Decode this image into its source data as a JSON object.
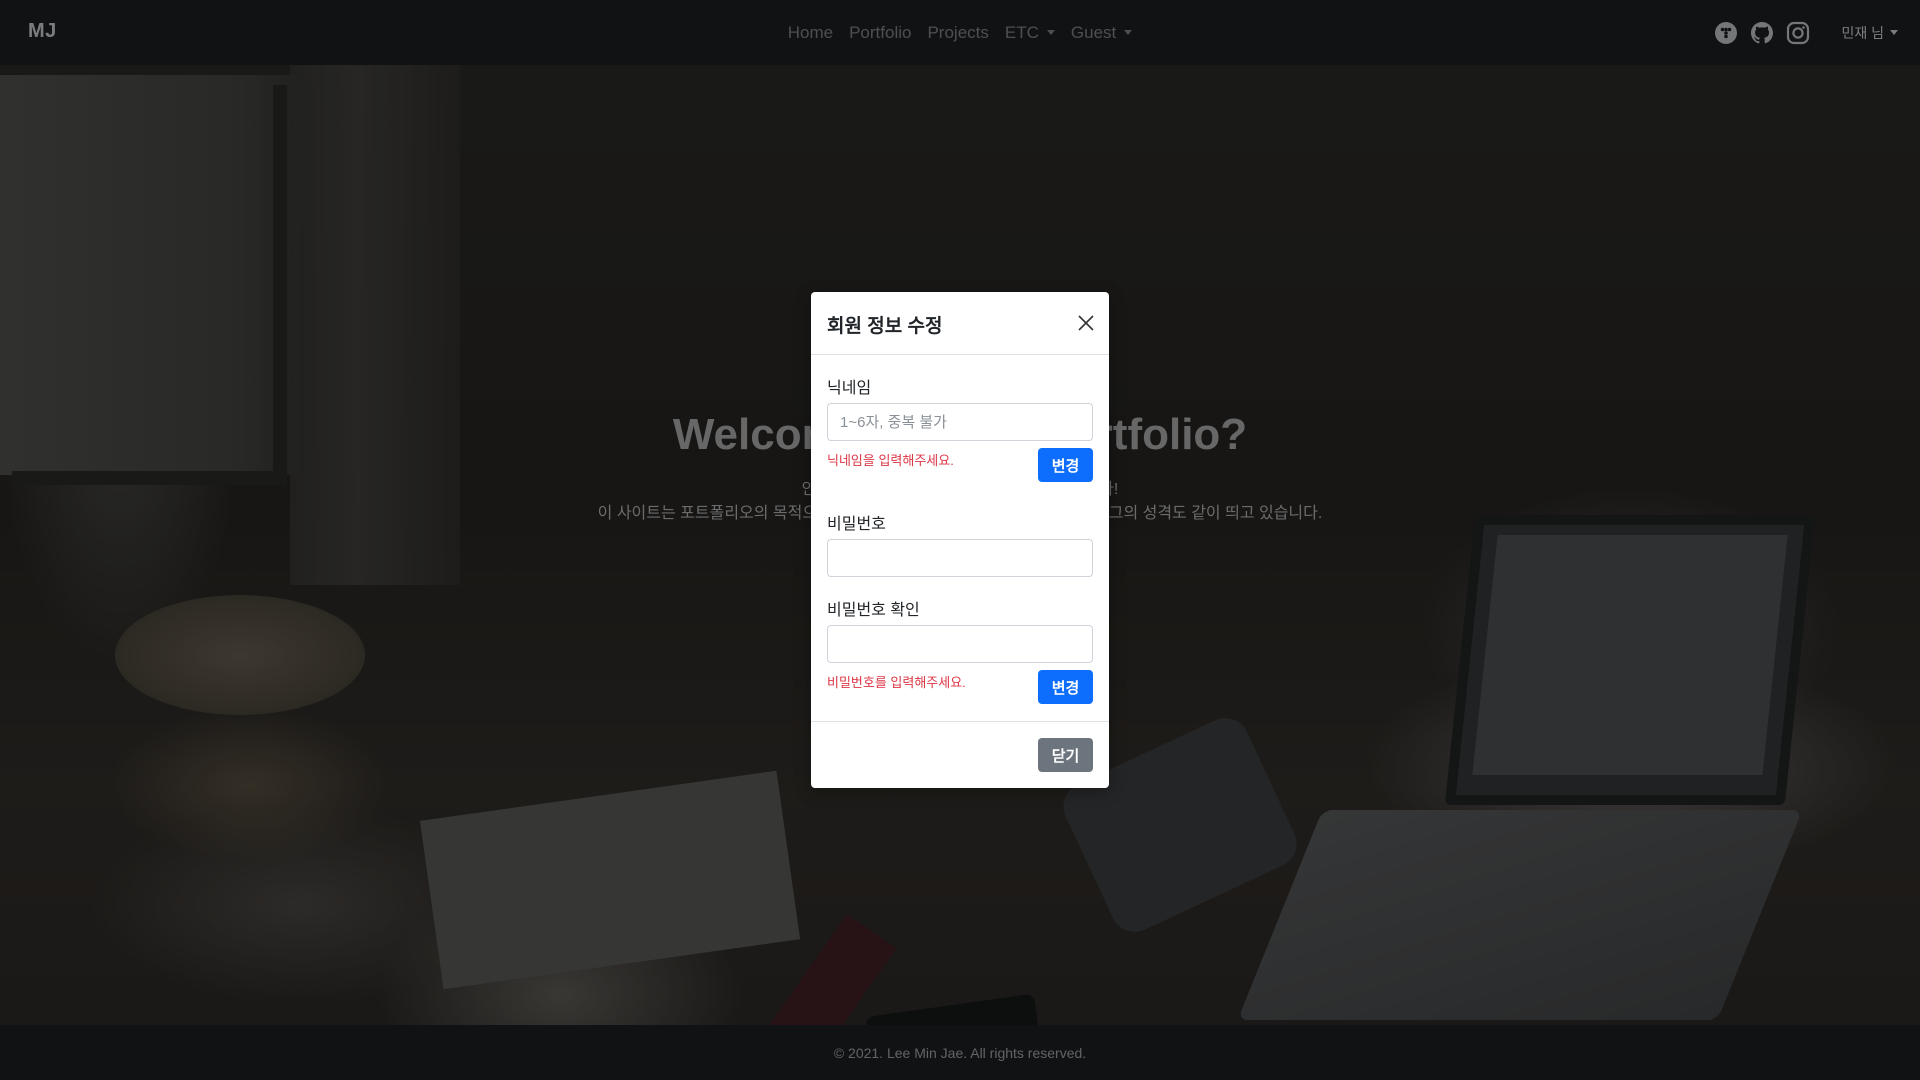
{
  "navbar": {
    "brand": "MJ",
    "links": [
      {
        "label": "Home"
      },
      {
        "label": "Portfolio"
      },
      {
        "label": "Projects"
      },
      {
        "label": "ETC"
      },
      {
        "label": "Guest"
      }
    ],
    "icons": [
      "blog-icon",
      "github-icon",
      "instagram-icon"
    ],
    "user_menu": "민재 님"
  },
  "hero": {
    "title": "Welcome to MJ's Portfolio?",
    "line1": "안녕하세요, 이민재의 포트폴리오 사이트입니다!",
    "line2": "이 사이트는 포트폴리오의 목적으로 만들어졌으며, 게시글 작성이 가능한 블로그의 성격도 같이 띄고 있습니다."
  },
  "modal": {
    "title": "회원 정보 수정",
    "nickname_label": "닉네임",
    "nickname_placeholder": "1~6자, 중복 불가",
    "nickname_error": "닉네임을 입력해주세요.",
    "nickname_button": "변경",
    "password_label": "비밀번호",
    "password_confirm_label": "비밀번호 확인",
    "password_error": "비밀번호를 입력해주세요.",
    "password_button": "변경",
    "close_button": "닫기"
  },
  "footer": {
    "copyright": "© 2021. Lee Min Jae. All rights reserved."
  },
  "colors": {
    "navbar_bg": "#212529",
    "primary": "#0d6efd",
    "secondary": "#6c757d",
    "error": "#dc3545"
  }
}
